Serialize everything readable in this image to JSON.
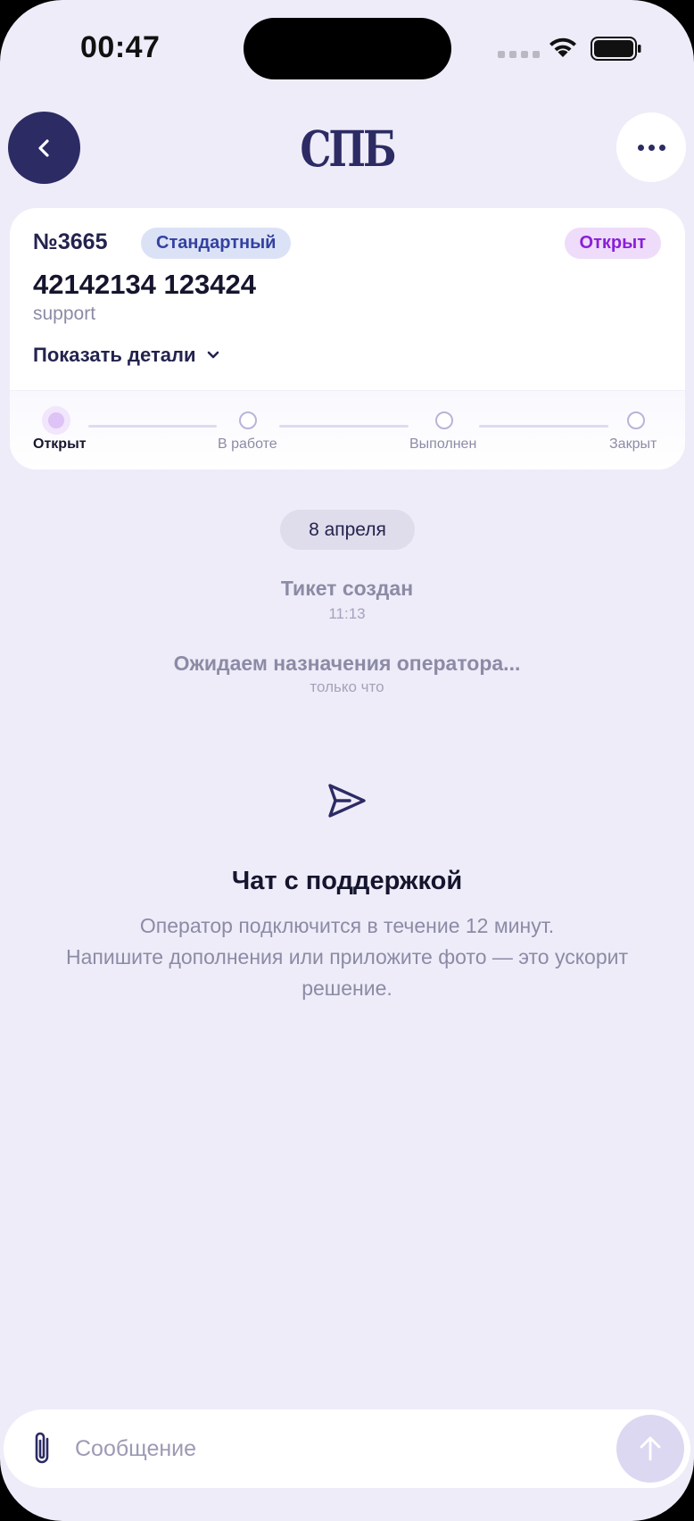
{
  "status_bar": {
    "time": "00:47"
  },
  "header": {
    "logo_text": "СПБ"
  },
  "ticket": {
    "number": "№3665",
    "priority_badge": "Стандартный",
    "status_badge": "Открыт",
    "title": "42142134 123424",
    "category": "support",
    "details_toggle": "Показать детали"
  },
  "progress": {
    "current_step": 0,
    "steps": [
      "Открыт",
      "В работе",
      "Выполнен",
      "Закрыт"
    ]
  },
  "timeline": {
    "date": "8 апреля",
    "events": [
      {
        "title": "Тикет создан",
        "time": "11:13"
      },
      {
        "title": "Ожидаем назначения оператора...",
        "time": "только что"
      }
    ]
  },
  "empty_state": {
    "icon": "send-icon",
    "title": "Чат с поддержкой",
    "line1": "Оператор подключится в течение 12 минут.",
    "line2": "Напишите дополнения или приложите фото — это ускорит решение."
  },
  "composer": {
    "placeholder": "Сообщение",
    "value": ""
  },
  "colors": {
    "background": "#EEECF8",
    "primary": "#2C2B64",
    "status_open": "#8B1FD8",
    "priority_standard": "#3341A0",
    "muted": "#8C8BA6"
  }
}
